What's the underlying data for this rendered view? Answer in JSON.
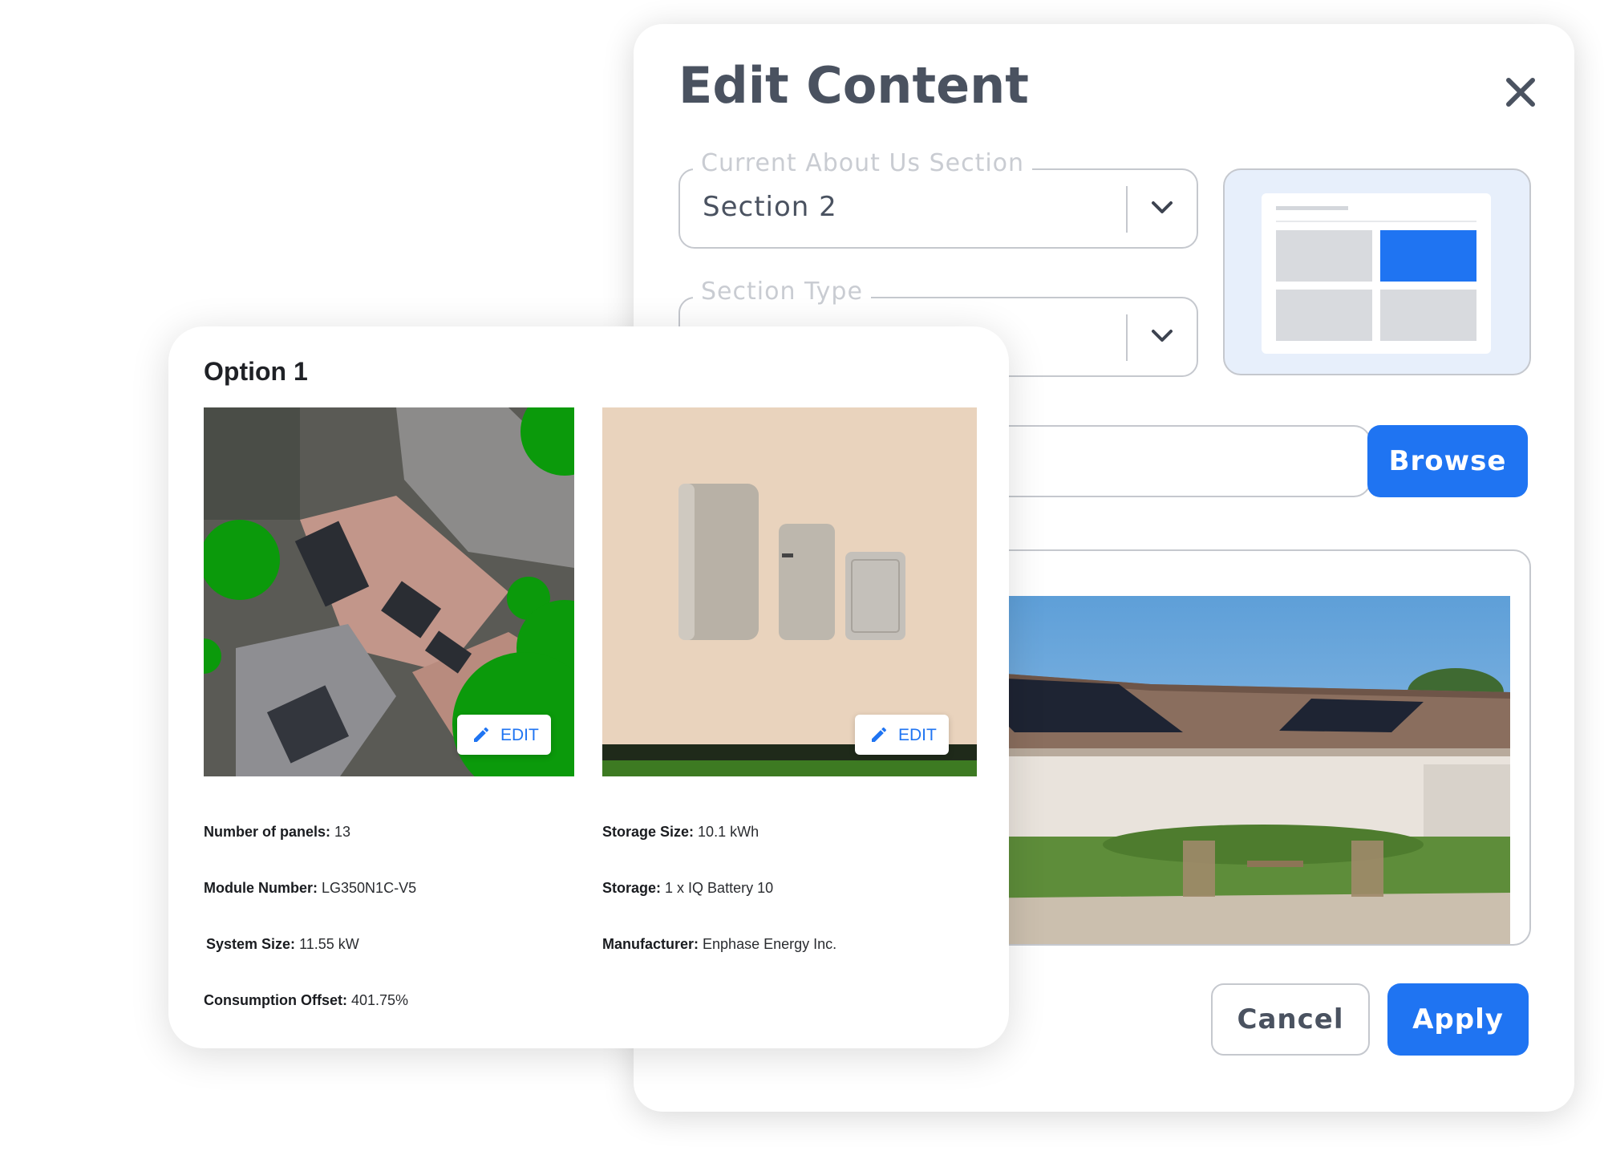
{
  "modal": {
    "title": "Edit Content",
    "current_section": {
      "label": "Current About Us Section",
      "value": "Section 2"
    },
    "section_type": {
      "label": "Section Type",
      "value": ""
    },
    "browse_label": "Browse",
    "cancel_label": "Cancel",
    "apply_label": "Apply"
  },
  "option_card": {
    "title": "Option 1",
    "edit_label": "EDIT",
    "left_specs": [
      {
        "label": "Number of panels:",
        "value": "13"
      },
      {
        "label": "Module Number:",
        "value": "LG350N1C-V5"
      },
      {
        "label": "System Size:",
        "value": "11.55 kW"
      },
      {
        "label": "Consumption Offset:",
        "value": "401.75%"
      }
    ],
    "right_specs": [
      {
        "label": "Storage Size:",
        "value": "10.1 kWh"
      },
      {
        "label": "Storage:",
        "value": "1 x IQ Battery 10"
      },
      {
        "label": "Manufacturer:",
        "value": "Enphase Energy Inc."
      }
    ]
  },
  "colors": {
    "accent": "#1f74f2",
    "heading": "#4a5260",
    "border": "#c5c8ce",
    "tree_overlay": "#0b9a0b"
  },
  "icons": [
    "close-icon",
    "chevron-down-icon",
    "pencil-icon"
  ]
}
